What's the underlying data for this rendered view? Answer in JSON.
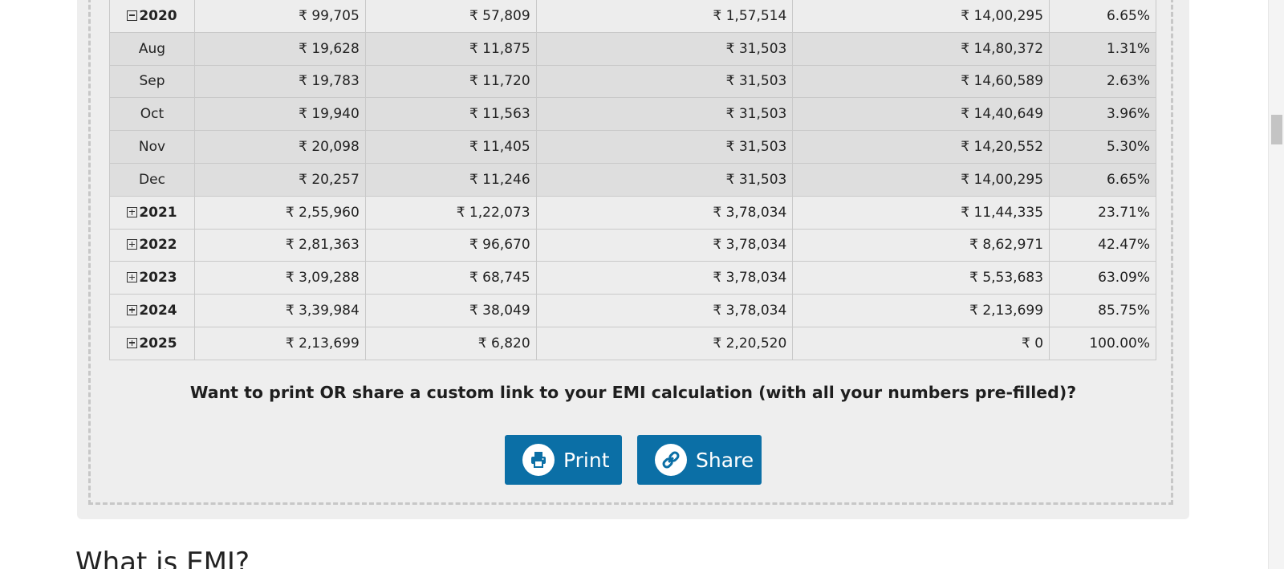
{
  "schedule": {
    "rows": [
      {
        "type": "year",
        "label": "2020",
        "expanded": true,
        "principal": "₹ 99,705",
        "interest": "₹ 57,809",
        "total": "₹ 1,57,514",
        "balance": "₹ 14,00,295",
        "paid_pct": "6.65%"
      },
      {
        "type": "month",
        "label": "Aug",
        "principal": "₹ 19,628",
        "interest": "₹ 11,875",
        "total": "₹ 31,503",
        "balance": "₹ 14,80,372",
        "paid_pct": "1.31%"
      },
      {
        "type": "month",
        "label": "Sep",
        "principal": "₹ 19,783",
        "interest": "₹ 11,720",
        "total": "₹ 31,503",
        "balance": "₹ 14,60,589",
        "paid_pct": "2.63%"
      },
      {
        "type": "month",
        "label": "Oct",
        "principal": "₹ 19,940",
        "interest": "₹ 11,563",
        "total": "₹ 31,503",
        "balance": "₹ 14,40,649",
        "paid_pct": "3.96%"
      },
      {
        "type": "month",
        "label": "Nov",
        "principal": "₹ 20,098",
        "interest": "₹ 11,405",
        "total": "₹ 31,503",
        "balance": "₹ 14,20,552",
        "paid_pct": "5.30%"
      },
      {
        "type": "month",
        "label": "Dec",
        "principal": "₹ 20,257",
        "interest": "₹ 11,246",
        "total": "₹ 31,503",
        "balance": "₹ 14,00,295",
        "paid_pct": "6.65%"
      },
      {
        "type": "year",
        "label": "2021",
        "expanded": false,
        "principal": "₹ 2,55,960",
        "interest": "₹ 1,22,073",
        "total": "₹ 3,78,034",
        "balance": "₹ 11,44,335",
        "paid_pct": "23.71%"
      },
      {
        "type": "year",
        "label": "2022",
        "expanded": false,
        "principal": "₹ 2,81,363",
        "interest": "₹ 96,670",
        "total": "₹ 3,78,034",
        "balance": "₹ 8,62,971",
        "paid_pct": "42.47%"
      },
      {
        "type": "year",
        "label": "2023",
        "expanded": false,
        "principal": "₹ 3,09,288",
        "interest": "₹ 68,745",
        "total": "₹ 3,78,034",
        "balance": "₹ 5,53,683",
        "paid_pct": "63.09%"
      },
      {
        "type": "year",
        "label": "2024",
        "expanded": false,
        "principal": "₹ 3,39,984",
        "interest": "₹ 38,049",
        "total": "₹ 3,78,034",
        "balance": "₹ 2,13,699",
        "paid_pct": "85.75%"
      },
      {
        "type": "year",
        "label": "2025",
        "expanded": false,
        "principal": "₹ 2,13,699",
        "interest": "₹ 6,820",
        "total": "₹ 2,20,520",
        "balance": "₹ 0",
        "paid_pct": "100.00%"
      }
    ]
  },
  "share_section": {
    "prompt": "Want to print OR share a custom link to your EMI calculation (with all your numbers pre-filled)?",
    "print_label": "Print",
    "share_label": "Share",
    "print_icon": "printer-icon",
    "share_icon": "link-icon",
    "button_color": "#0b6fa6"
  },
  "next_section": {
    "heading": "What is EMI?"
  },
  "colors": {
    "panel_bg": "#eeeeee",
    "year_row_bg": "#ededed",
    "month_row_bg": "#dedede"
  }
}
